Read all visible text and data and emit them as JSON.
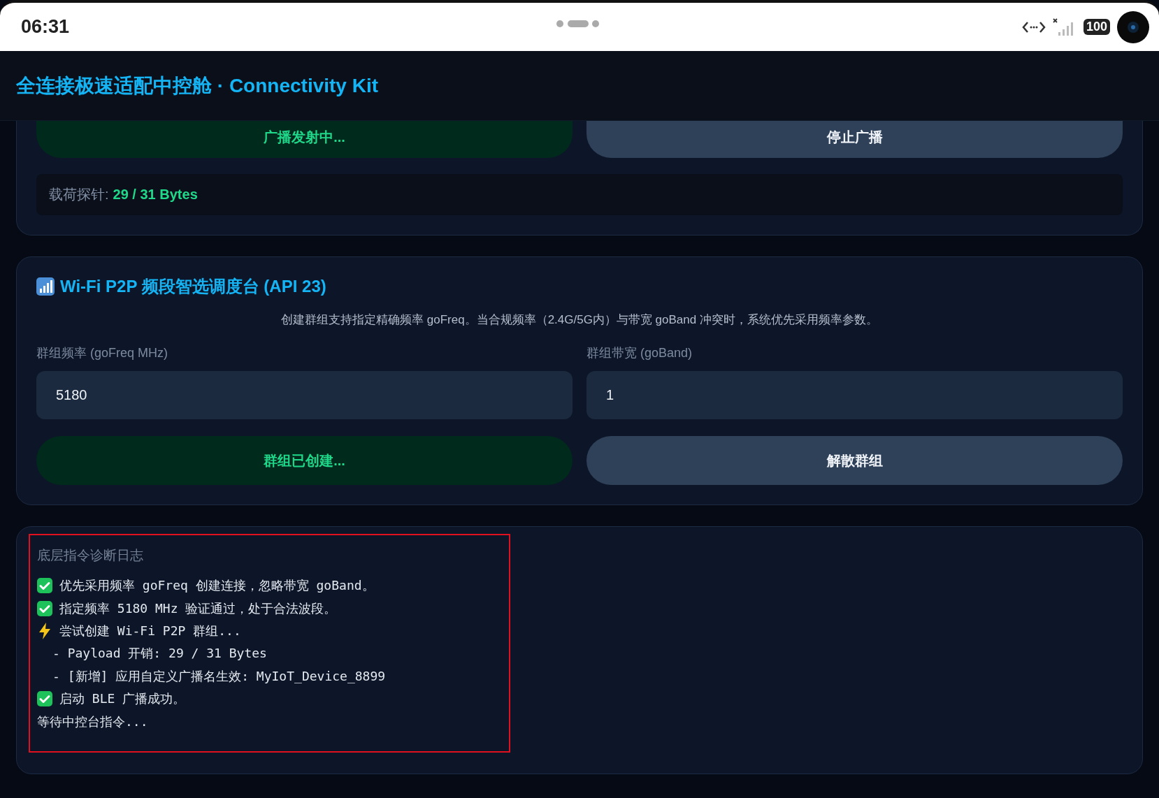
{
  "status_bar": {
    "time": "06:31",
    "battery": "100"
  },
  "header": {
    "title": "全连接极速适配中控舱 · Connectivity Kit"
  },
  "broadcast_card": {
    "buttons": [
      {
        "label": "广播发射中...",
        "kind": "active"
      },
      {
        "label": "停止广播",
        "kind": "secondary"
      }
    ],
    "payload": {
      "label": "载荷探针:",
      "value": "29 / 31 Bytes"
    }
  },
  "p2p_card": {
    "title": "Wi-Fi P2P 频段智选调度台 (API 23)",
    "description": "创建群组支持指定精确频率 goFreq。当合规频率（2.4G/5G内）与带宽 goBand 冲突时，系统优先采用频率参数。",
    "fields": [
      {
        "label": "群组频率 (goFreq MHz)",
        "value": "5180"
      },
      {
        "label": "群组带宽 (goBand)",
        "value": "1"
      }
    ],
    "buttons": [
      {
        "label": "群组已创建...",
        "kind": "active"
      },
      {
        "label": "解散群组",
        "kind": "secondary"
      }
    ]
  },
  "log": {
    "title": "底层指令诊断日志",
    "lines": [
      {
        "kind": "success",
        "text": "优先采用频率 goFreq 创建连接，忽略带宽 goBand。"
      },
      {
        "kind": "success",
        "text": "指定频率 5180 MHz 验证通过，处于合法波段。"
      },
      {
        "kind": "action",
        "text": "尝试创建 Wi-Fi P2P 群组..."
      },
      {
        "kind": "detail",
        "text": "- Payload 开销: 29 / 31 Bytes"
      },
      {
        "kind": "detail",
        "text": "- [新增] 应用自定义广播名生效: MyIoT_Device_8899"
      },
      {
        "kind": "success",
        "text": "启动 BLE 广播成功。"
      },
      {
        "kind": "plain",
        "text": "等待中控台指令..."
      }
    ]
  }
}
